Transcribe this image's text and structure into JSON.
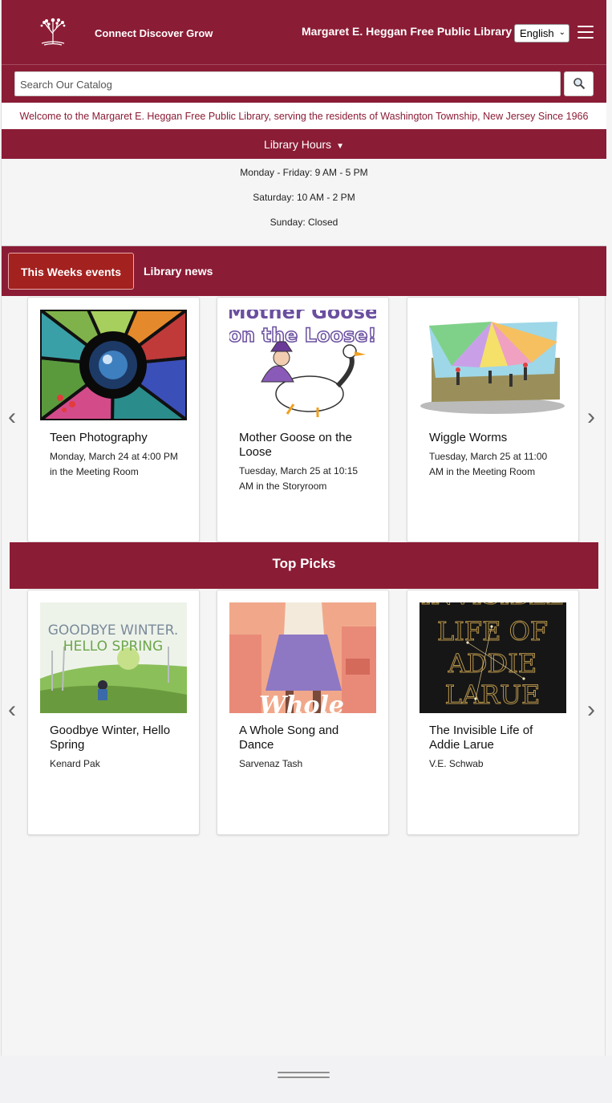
{
  "header": {
    "tagline": "Connect Discover Grow",
    "library_name": "Margaret E. Heggan Free Public Library",
    "language": "English"
  },
  "search": {
    "placeholder": "Search Our Catalog"
  },
  "welcome": "Welcome to the Margaret E. Heggan Free Public Library, serving the residents of Washington Township, New Jersey Since 1966",
  "hours": {
    "label": "Library Hours",
    "lines": [
      "Monday - Friday: 9 AM - 5 PM",
      "Saturday: 10 AM - 2 PM",
      "Sunday: Closed"
    ]
  },
  "tabs": {
    "active": "This Weeks events",
    "other": "Library news"
  },
  "events": [
    {
      "title": "Teen Photography",
      "detail": "Monday, March 24 at 4:00 PM in the Meeting Room"
    },
    {
      "title": "Mother Goose on the Loose",
      "detail": "Tuesday, March 25 at 10:15 AM in the Storyroom",
      "art_text_1": "Mother Goose",
      "art_text_2": "on the Loose!"
    },
    {
      "title": "Wiggle Worms",
      "detail": "Tuesday, March 25 at 11:00 AM in the Meeting Room"
    }
  ],
  "top_picks": {
    "heading": "Top Picks",
    "items": [
      {
        "title": "Goodbye Winter, Hello Spring",
        "author": "Kenard Pak",
        "cover_line_1": "GOODBYE WINTER.",
        "cover_line_2": "HELLO SPRING"
      },
      {
        "title": "A Whole Song and Dance",
        "author": "Sarvenaz Tash",
        "cover_text": "Whole"
      },
      {
        "title": "The Invisible Life of Addie Larue",
        "author": "V.E. Schwab",
        "cover_line_1": "INVISIBLE",
        "cover_line_2": "LIFE OF",
        "cover_line_3": "ADDIE",
        "cover_line_4": "LARUE"
      }
    ]
  },
  "colors": {
    "brand": "#8b1c35",
    "active_tab": "#a3211f"
  }
}
